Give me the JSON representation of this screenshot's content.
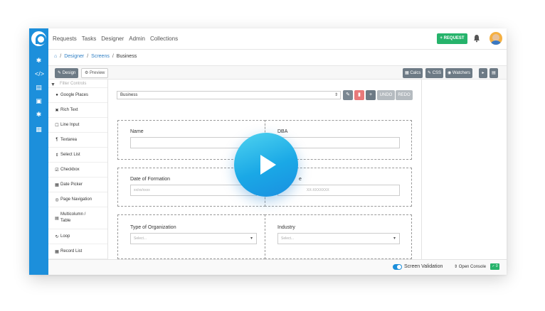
{
  "rail": {
    "icons": [
      "logo-icon",
      "gear-icon",
      "code-icon",
      "document-icon",
      "lock-icon",
      "settings-icon",
      "list-icon"
    ]
  },
  "topbar": {
    "nav": [
      "Requests",
      "Tasks",
      "Designer",
      "Admin",
      "Collections"
    ],
    "request_button": "+ REQUEST"
  },
  "breadcrumb": {
    "items": [
      "Designer",
      "Screens"
    ],
    "current": "Business"
  },
  "toolbar": {
    "design": "Design",
    "preview": "Preview",
    "calcs": "Calcs",
    "css": "CSS",
    "watchers": "Watchers"
  },
  "palette": {
    "filter_placeholder": "Filter Controls",
    "items": [
      {
        "label": "Google Places",
        "icon": "map-pin-icon"
      },
      {
        "label": "Rich Text",
        "icon": "rich-text-icon"
      },
      {
        "label": "Line Input",
        "icon": "line-input-icon"
      },
      {
        "label": "Textarea",
        "icon": "paragraph-icon"
      },
      {
        "label": "Select List",
        "icon": "select-list-icon"
      },
      {
        "label": "Checkbox",
        "icon": "checkbox-icon"
      },
      {
        "label": "Date Picker",
        "icon": "calendar-icon"
      },
      {
        "label": "Page Navigation",
        "icon": "page-nav-icon"
      },
      {
        "label": "Multicolumn / Table",
        "icon": "table-icon"
      },
      {
        "label": "Loop",
        "icon": "loop-icon"
      },
      {
        "label": "Record List",
        "icon": "record-list-icon"
      }
    ]
  },
  "canvas": {
    "screen_select": "Business",
    "undo": "UNDO",
    "redo": "REDO",
    "fields": {
      "name_label": "Name",
      "dba_label": "DBA",
      "formation_label": "Date of Formation",
      "formation_placeholder": "xx/xx/xxxx",
      "second_label": "e",
      "second_placeholder": "XX-XXXXXXX",
      "org_label": "Type of Organization",
      "org_placeholder": "Select...",
      "industry_label": "Industry",
      "industry_placeholder": "Select..."
    }
  },
  "footer": {
    "screen_validation": "Screen Validation",
    "open_console": "Open Console",
    "console_badge": "0"
  },
  "colors": {
    "rail": "#1c8fdb",
    "request": "#26b36b",
    "toolbar_button": "#6d7a85",
    "play": "#1aa8e6"
  }
}
